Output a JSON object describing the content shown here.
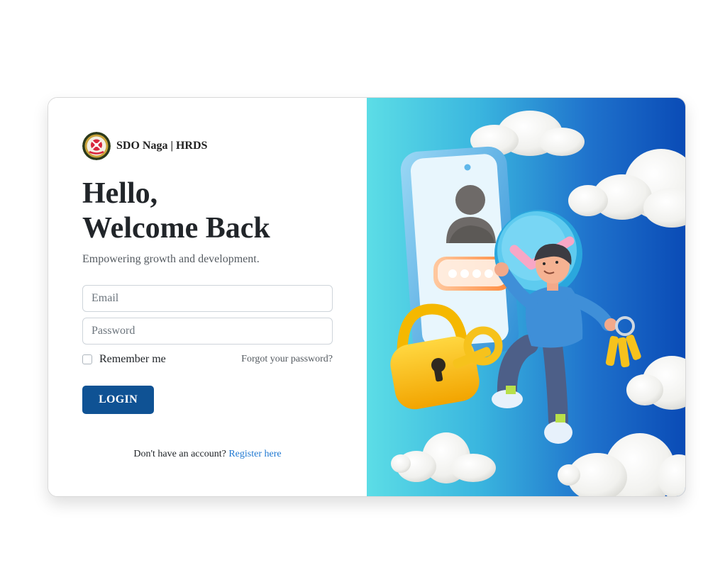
{
  "brand": {
    "name": "SDO Naga | HRDS"
  },
  "heading": {
    "line1": "Hello,",
    "line2": "Welcome Back"
  },
  "subtitle": "Empowering growth and development.",
  "form": {
    "email_placeholder": "Email",
    "email_value": "",
    "password_placeholder": "Password",
    "password_value": "",
    "remember_label": "Remember me",
    "remember_checked": false,
    "forgot_label": "Forgot your password?",
    "login_label": "LOGIN"
  },
  "register": {
    "prompt": "Don't have an account?",
    "link_label": "Register here"
  },
  "colors": {
    "primary_button": "#0f5294",
    "link": "#1f78d1",
    "panel_gradient_start": "#5cdde6",
    "panel_gradient_end": "#0a4bb6"
  },
  "illustration": {
    "elements": [
      "cloud-icon",
      "phone-icon",
      "user-avatar-icon",
      "password-dots-icon",
      "checkmark-badge-icon",
      "padlock-icon",
      "key-icon",
      "person-figure",
      "keyring-icon"
    ]
  }
}
